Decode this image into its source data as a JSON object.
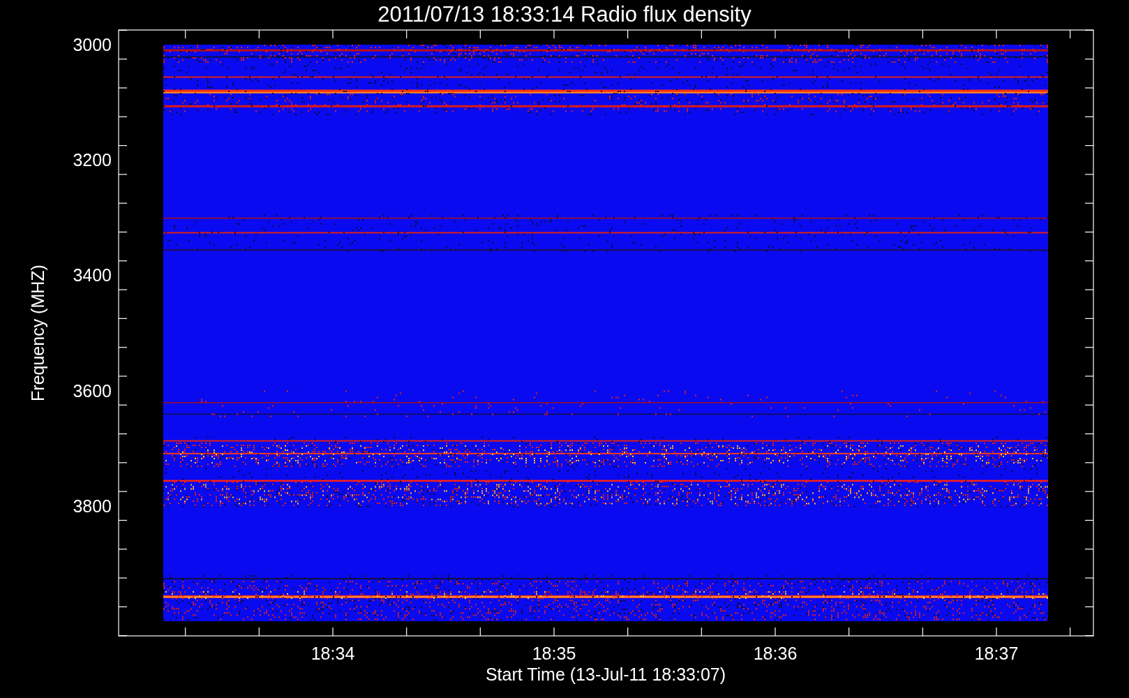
{
  "plot": {
    "title": "2011/07/13 18:33:14 Radio flux density",
    "ylabel": "Frequency (MHZ)",
    "ytick_labels": [
      "3000",
      "3200",
      "3400",
      "3600",
      "3800"
    ],
    "xtick_labels": [
      "18:34",
      "18:35",
      "18:36",
      "18:37"
    ],
    "xlabel": "Start Time (13-Jul-11 18:33:07)"
  }
}
